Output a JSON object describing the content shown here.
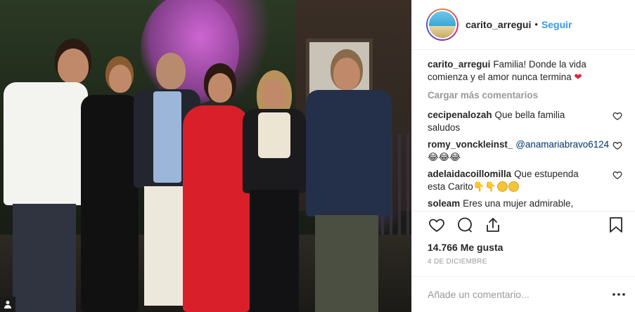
{
  "post": {
    "username": "carito_arregui",
    "dot": "•",
    "follow_label": "Seguir",
    "caption_user": "carito_arregui",
    "caption_text": "Familia! Donde la vida comienza y el amor nunca termina",
    "caption_emoji": "❤",
    "load_more": "Cargar más comentarios",
    "comments": [
      {
        "user": "cecipenalozah",
        "text": "Que bella familia saludos"
      },
      {
        "user": "romy_vonckleinst_",
        "mention": "@anamariabravo6124",
        "emoji": "😂😂😂"
      },
      {
        "user": "adelaidacoillomilla",
        "text": "Que estupenda esta Carito👇👇"
      },
      {
        "user": "soleam",
        "text": "Eres una mujer admirable,"
      }
    ],
    "likes": "14.766 Me gusta",
    "date": "4 DE DICIEMBRE",
    "add_comment_placeholder": "Añade un comentario..."
  },
  "icons": {
    "heart": "heart-icon",
    "comment": "comment-icon",
    "share": "share-icon",
    "bookmark": "bookmark-icon",
    "more": "more-options-icon"
  },
  "colors": {
    "accent": "#3897f0",
    "text": "#262626",
    "muted": "#999999",
    "border": "#efefef"
  }
}
